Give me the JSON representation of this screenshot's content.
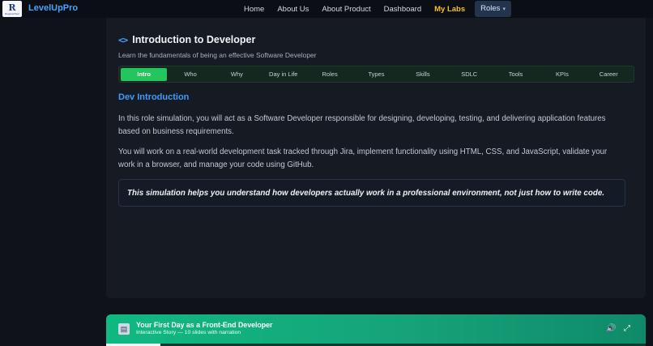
{
  "navbar": {
    "logo_letter": "R",
    "logo_sub": "RegenerNext",
    "brand": "LevelUpPro",
    "links": [
      "Home",
      "About Us",
      "About Product",
      "Dashboard"
    ],
    "my_labs": "My Labs",
    "roles": "Roles",
    "accent_color": "#f4c11c"
  },
  "page": {
    "title": "Introduction to Developer",
    "subtitle": "Learn the fundamentals of being an effective Software Developer",
    "tabs": [
      "Intro",
      "Who",
      "Why",
      "Day in Life",
      "Roles",
      "Types",
      "Skills",
      "SDLC",
      "Tools",
      "KPIs",
      "Career"
    ],
    "active_tab": "Intro",
    "section_title": "Dev Introduction",
    "paragraph1": "In this role simulation, you will act as a Software Developer responsible for designing, developing, testing, and delivering application features based on business requirements.",
    "paragraph2": "You will work on a real-world development task tracked through Jira, implement functionality using HTML, CSS, and JavaScript, validate your work in a browser, and manage your code using GitHub.",
    "callout": "This simulation helps you understand how developers actually work in a professional environment, not just how to write code."
  },
  "story": {
    "title": "Your First Day as a Front-End Developer",
    "subtitle": "Interactive Story — 10 slides with narration",
    "progress": 0.1
  },
  "icons": {
    "code": "code-icon",
    "story": "slides-icon",
    "sound": "speaker-icon",
    "expand": "fullscreen-icon"
  }
}
